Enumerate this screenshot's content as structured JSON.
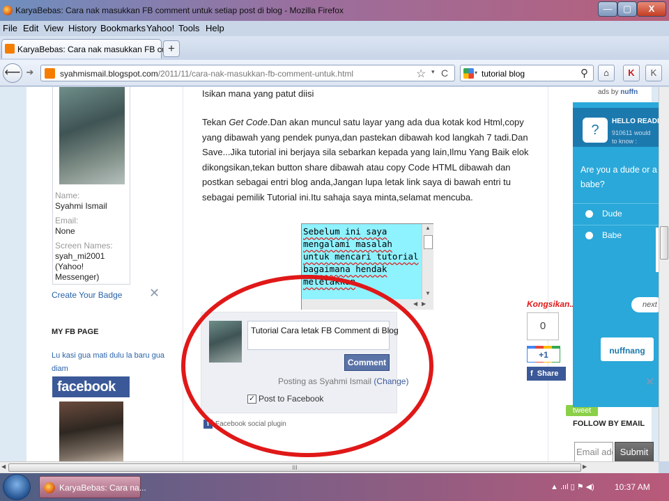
{
  "window": {
    "title": "KaryaBebas: Cara nak masukkan FB comment untuk setiap post di blog - Mozilla Firefox",
    "minimize": "—",
    "maximize": "▢",
    "close": "X"
  },
  "menu": [
    "File",
    "Edit",
    "View",
    "History",
    "Bookmarks",
    "Yahoo!",
    "Tools",
    "Help"
  ],
  "tabs": [
    {
      "label": "KaryaBebas: Cara nak masukkan FB com...",
      "close": "×"
    }
  ],
  "newtab": "+",
  "nav": {
    "back": "⟵",
    "forward": "➔",
    "url_domain": "syahmismail.blogspot.com",
    "url_prefix": "",
    "url_path": "/2011/11/cara-nak-masukkan-fb-comment-untuk.html",
    "star": "☆",
    "dropdown": "▾",
    "reload": "C",
    "search_value": "tutorial blog",
    "search_icon": "⚲",
    "home": "⌂",
    "k_icon": "K",
    "k2_icon": "K"
  },
  "sidebar": {
    "profile": {
      "name_label": "Name:",
      "name": "Syahmi Ismail",
      "email_label": "Email:",
      "email": "None",
      "screen_label": "Screen Names:",
      "screen_1": "syah_mi2001",
      "screen_2": "(Yahoo!",
      "screen_3": "Messenger)"
    },
    "create_badge": "Create Your Badge",
    "tools_icon": "✕",
    "fb_page_heading": "MY FB PAGE",
    "fb_page_text": "Lu kasi gua mati dulu la baru gua diam",
    "fb_logo": "facebook"
  },
  "article": {
    "intro": "Isikan mana yang patut diisi",
    "para_prefix": "Tekan ",
    "para_italic": "Get Code",
    "para_body": ".Dan akan muncul satu layar yang ada dua kotak kod Html,copy yang dibawah yang pendek punya,dan pastekan dibawah kod langkah 7 tadi.Dan Save...Jika tutorial ini berjaya sila sebarkan kepada yang lain,Ilmu Yang Baik elok dikongsikan,tekan button share dibawah atau copy Code HTML dibawah dan postkan sebagai entri blog anda,Jangan lupa letak link saya di bawah entri tu sebagai pemilik Tutorial ini.Itu sahaja saya minta,selamat mencuba.",
    "code_text": "Sebelum ini saya mengalami masalah untuk mencari tutorial bagaimana hendak meletakkan"
  },
  "fb_comment": {
    "input_value": "Tutorial Cara letak FB Comment di Blog",
    "button": "Comment",
    "posting_as": "Posting as Syahmi Ismail",
    "change": "(Change)",
    "post_to_fb": "Post to Facebook",
    "checkbox_mark": "✓",
    "social_plugin": "Facebook social plugin",
    "f_icon": "f"
  },
  "share": {
    "kongsikan": "Kongsikan.X",
    "count": "0",
    "plusone": "+1",
    "share_f": "f",
    "share": "Share",
    "tweet": "tweet"
  },
  "ad": {
    "ads_by_prefix": "ads by ",
    "ads_by_brand": "nuffn",
    "hello": "HELLO READE",
    "sub_1": "910611 would",
    "sub_2": "to know :",
    "question": "Are you a dude or a babe?",
    "opt_1": "Dude",
    "opt_2": "Babe",
    "next": "next",
    "logo": "nuffnang",
    "icon": "?"
  },
  "follow": {
    "heading": "FOLLOW BY EMAIL",
    "email_placeholder": "Email address...",
    "submit": "Submit"
  },
  "scroll": {
    "grip": "III"
  },
  "taskbar": {
    "item": "KaryaBebas: Cara na...",
    "tray": "▲ .ııl ▯ ⚑ ◀)",
    "clock": "10:37 AM"
  },
  "colors": {
    "accent_red": "#e01818",
    "facebook_blue": "#3b5998",
    "nuffnang_blue": "#2aa8d9",
    "link_blue": "#2962a8",
    "code_cyan": "#8ff2ff"
  }
}
